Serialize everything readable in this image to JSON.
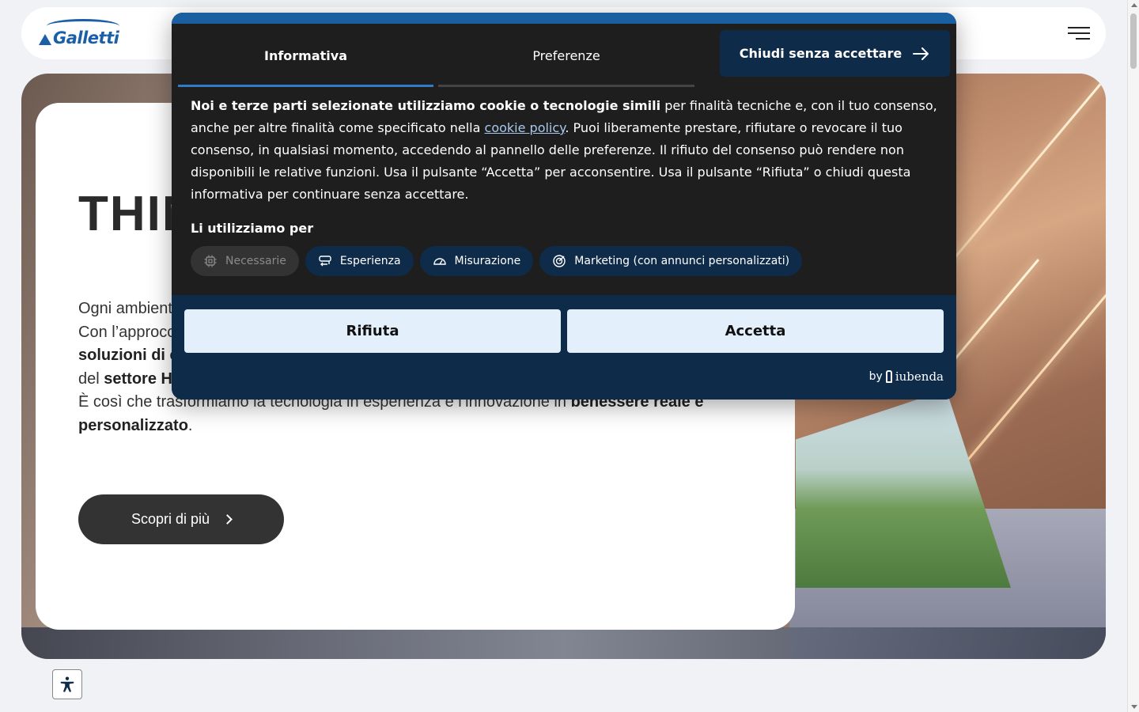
{
  "header": {
    "logo_text": "Galletti",
    "menu_icon": "hamburger-icon"
  },
  "hero": {
    "title": "THIN",
    "lead_lines": [
      "Ogni ambient",
      "Con l’approcc",
      "soluzioni di c",
      "del ",
      "settore H",
      "È così che trasformiamo la tecnologia in esperienza e l’innovazione in ",
      "benessere reale e",
      "personalizzato",
      "."
    ],
    "cta_label": "Scopri di più"
  },
  "accessibility_icon": "accessibility-icon",
  "cookie_banner": {
    "tabs": [
      {
        "label": "Informativa",
        "active": true
      },
      {
        "label": "Preferenze",
        "active": false
      }
    ],
    "close_label": "Chiudi senza accettare",
    "intro_bold": "Noi e terze parti selezionate utilizziamo cookie o tecnologie simili",
    "intro_1": " per finalità tecniche e, con il tuo consenso, anche per altre finalità come specificato nella ",
    "policy_link": "cookie policy",
    "intro_2": ". Puoi liberamente prestare, rifiutare o revocare il tuo consenso, in qualsiasi momento, accedendo al pannello delle preferenze. Il rifiuto del consenso può rendere non disponibili le relative funzioni. Usa il pulsante “Accetta” per acconsentire. Usa il pulsante “Rifiuta” o chiudi questa informativa per continuare senza accettare.",
    "uses_title": "Li utilizziamo per",
    "purposes": [
      {
        "label": "Necessarie",
        "icon": "chip-icon",
        "enabled": false
      },
      {
        "label": "Esperienza",
        "icon": "refresh-icon",
        "enabled": true
      },
      {
        "label": "Misurazione",
        "icon": "gauge-icon",
        "enabled": true
      },
      {
        "label": "Marketing (con annunci personalizzati)",
        "icon": "target-icon",
        "enabled": true
      }
    ],
    "reject_label": "Rifiuta",
    "accept_label": "Accetta",
    "brand_by": "by",
    "brand_name": "iubenda"
  },
  "colors": {
    "banner_bg": "#1e1e1e",
    "banner_footer": "#0f2b4a",
    "accent_blue": "#1a5fa0",
    "button_light": "#e3effb",
    "cta_dark": "#333333"
  }
}
